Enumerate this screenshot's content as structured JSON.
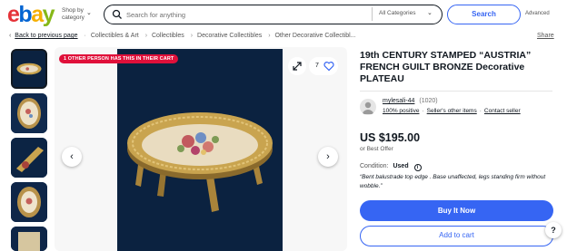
{
  "header": {
    "logo": {
      "e": "e",
      "b": "b",
      "a": "a",
      "y": "y"
    },
    "shop_by_line1": "Shop by",
    "shop_by_line2": "category",
    "search_placeholder": "Search for anything",
    "category_selected": "All Categories",
    "search_button": "Search",
    "advanced": "Advanced"
  },
  "breadcrumb": {
    "back": "Back to previous page",
    "items": [
      "Collectibles & Art",
      "Collectibles",
      "Decorative Collectibles",
      "Other Decorative Collectibl..."
    ],
    "share": "Share"
  },
  "gallery": {
    "cart_badge": "1 OTHER PERSON HAS THIS IN THEIR CART",
    "watch_count": "7",
    "prev_icon": "‹",
    "next_icon": "›"
  },
  "listing": {
    "title": "19th CENTURY STAMPED “AUSTRIA” FRENCH GUILT BRONZE Decorative PLATEAU",
    "seller_name": "mylesali-44",
    "seller_count": "(1020)",
    "positive": "100% positive",
    "other_items": "Seller's other items",
    "contact": "Contact seller",
    "price": "US $195.00",
    "best_offer": "or Best Offer",
    "condition_label": "Condition:",
    "condition_value": "Used",
    "condition_note": "“Bent balustrade top edge . Base unaffected, legs standing firm without wobble.”",
    "buy_now": "Buy It Now",
    "add_to_cart": "Add to cart",
    "help": "?"
  },
  "colors": {
    "accent": "#3665f3",
    "badge": "#e0103a",
    "text": "#111820"
  }
}
